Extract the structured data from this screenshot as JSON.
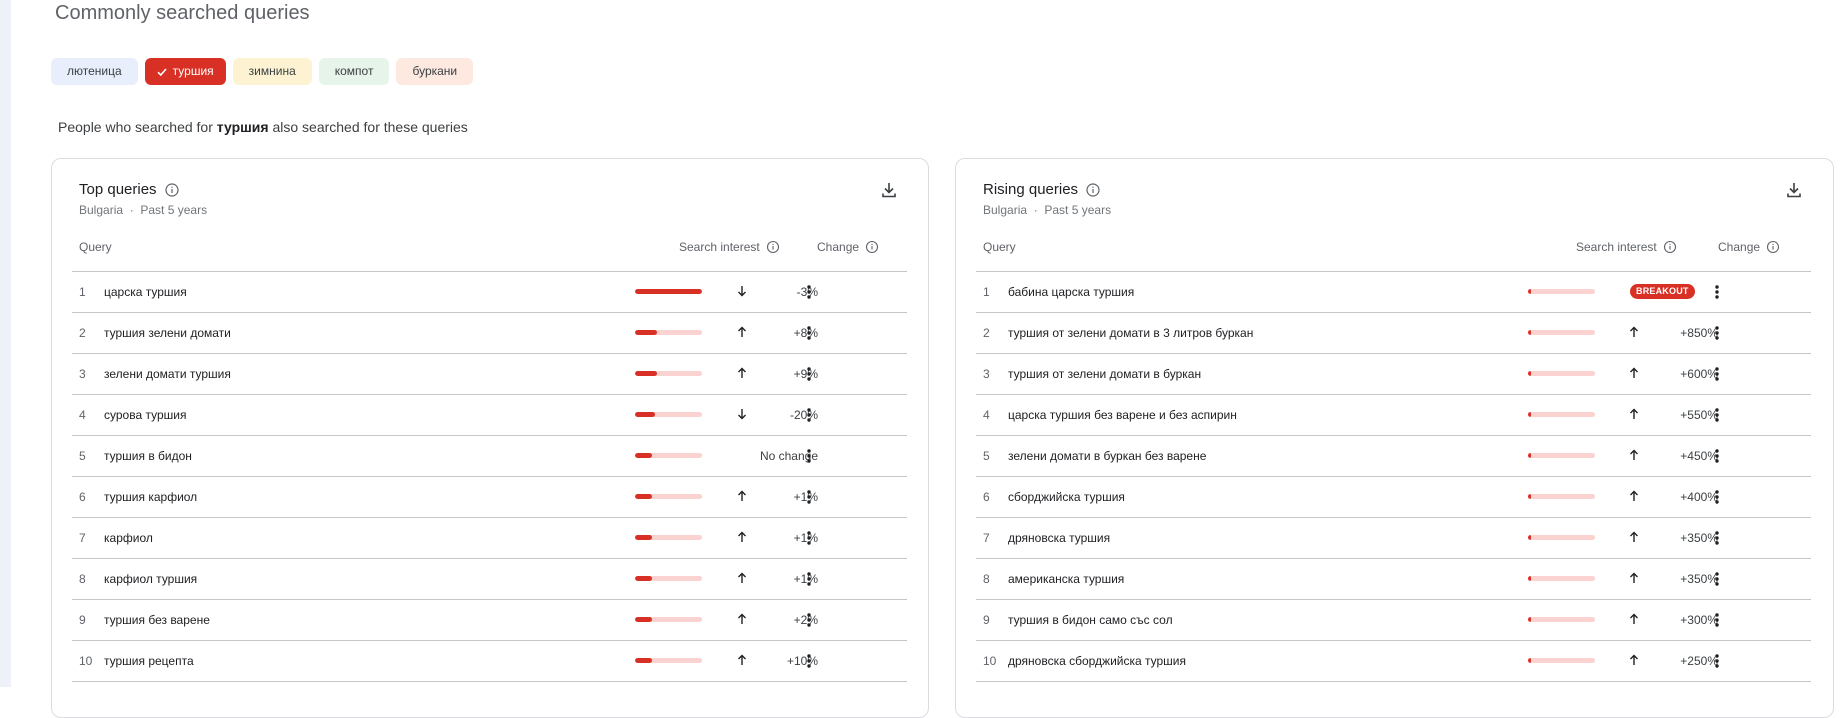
{
  "page_title": "Commonly searched queries",
  "chips": [
    {
      "label": "лютеница",
      "selected": false
    },
    {
      "label": "туршия",
      "selected": true
    },
    {
      "label": "зимнина",
      "selected": false
    },
    {
      "label": "компот",
      "selected": false
    },
    {
      "label": "буркани",
      "selected": false
    }
  ],
  "subtitle": {
    "prefix": "People who searched for ",
    "term": "туршия",
    "suffix": " also searched for these queries"
  },
  "top": {
    "title": "Top queries",
    "region": "Bulgaria",
    "period": "Past 5 years",
    "col_query": "Query",
    "col_interest": "Search interest",
    "col_change": "Change",
    "rows": [
      {
        "rank": "1",
        "query": "царска туршия",
        "interest": 1.0,
        "dir": "down",
        "change": "-3%"
      },
      {
        "rank": "2",
        "query": "туршия зелени домати",
        "interest": 0.33,
        "dir": "up",
        "change": "+8%"
      },
      {
        "rank": "3",
        "query": "зелени домати туршия",
        "interest": 0.33,
        "dir": "up",
        "change": "+9%"
      },
      {
        "rank": "4",
        "query": "сурова туршия",
        "interest": 0.3,
        "dir": "down",
        "change": "-20%"
      },
      {
        "rank": "5",
        "query": "туршия в бидон",
        "interest": 0.26,
        "dir": "none",
        "change": "No change"
      },
      {
        "rank": "6",
        "query": "туршия карфиол",
        "interest": 0.25,
        "dir": "up",
        "change": "+1%"
      },
      {
        "rank": "7",
        "query": "карфиол",
        "interest": 0.25,
        "dir": "up",
        "change": "+1%"
      },
      {
        "rank": "8",
        "query": "карфиол туршия",
        "interest": 0.25,
        "dir": "up",
        "change": "+1%"
      },
      {
        "rank": "9",
        "query": "туршия без варене",
        "interest": 0.25,
        "dir": "up",
        "change": "+2%"
      },
      {
        "rank": "10",
        "query": "туршия рецепта",
        "interest": 0.25,
        "dir": "up",
        "change": "+10%"
      }
    ]
  },
  "rising": {
    "title": "Rising queries",
    "region": "Bulgaria",
    "period": "Past 5 years",
    "col_query": "Query",
    "col_interest": "Search interest",
    "col_change": "Change",
    "rows": [
      {
        "rank": "1",
        "query": "бабина царска туршия",
        "interest": 0.04,
        "dir": "breakout",
        "change": "BREAKOUT"
      },
      {
        "rank": "2",
        "query": "туршия от зелени домати в 3 литров буркан",
        "interest": 0.04,
        "dir": "up",
        "change": "+850%"
      },
      {
        "rank": "3",
        "query": "туршия от зелени домати в буркан",
        "interest": 0.04,
        "dir": "up",
        "change": "+600%"
      },
      {
        "rank": "4",
        "query": "царска туршия без варене и без аспирин",
        "interest": 0.04,
        "dir": "up",
        "change": "+550%"
      },
      {
        "rank": "5",
        "query": "зелени домати в буркан без варене",
        "interest": 0.04,
        "dir": "up",
        "change": "+450%"
      },
      {
        "rank": "6",
        "query": "сборджийска туршия",
        "interest": 0.04,
        "dir": "up",
        "change": "+400%"
      },
      {
        "rank": "7",
        "query": "дряновска туршия",
        "interest": 0.04,
        "dir": "up",
        "change": "+350%"
      },
      {
        "rank": "8",
        "query": "американска туршия",
        "interest": 0.04,
        "dir": "up",
        "change": "+350%"
      },
      {
        "rank": "9",
        "query": "туршия в бидон само със сол",
        "interest": 0.04,
        "dir": "up",
        "change": "+300%"
      },
      {
        "rank": "10",
        "query": "дряновска сборджийска туршия",
        "interest": 0.04,
        "dir": "up",
        "change": "+250%"
      }
    ]
  },
  "colors": {
    "accent": "#d93025",
    "bar_track": "#fad2cf"
  }
}
